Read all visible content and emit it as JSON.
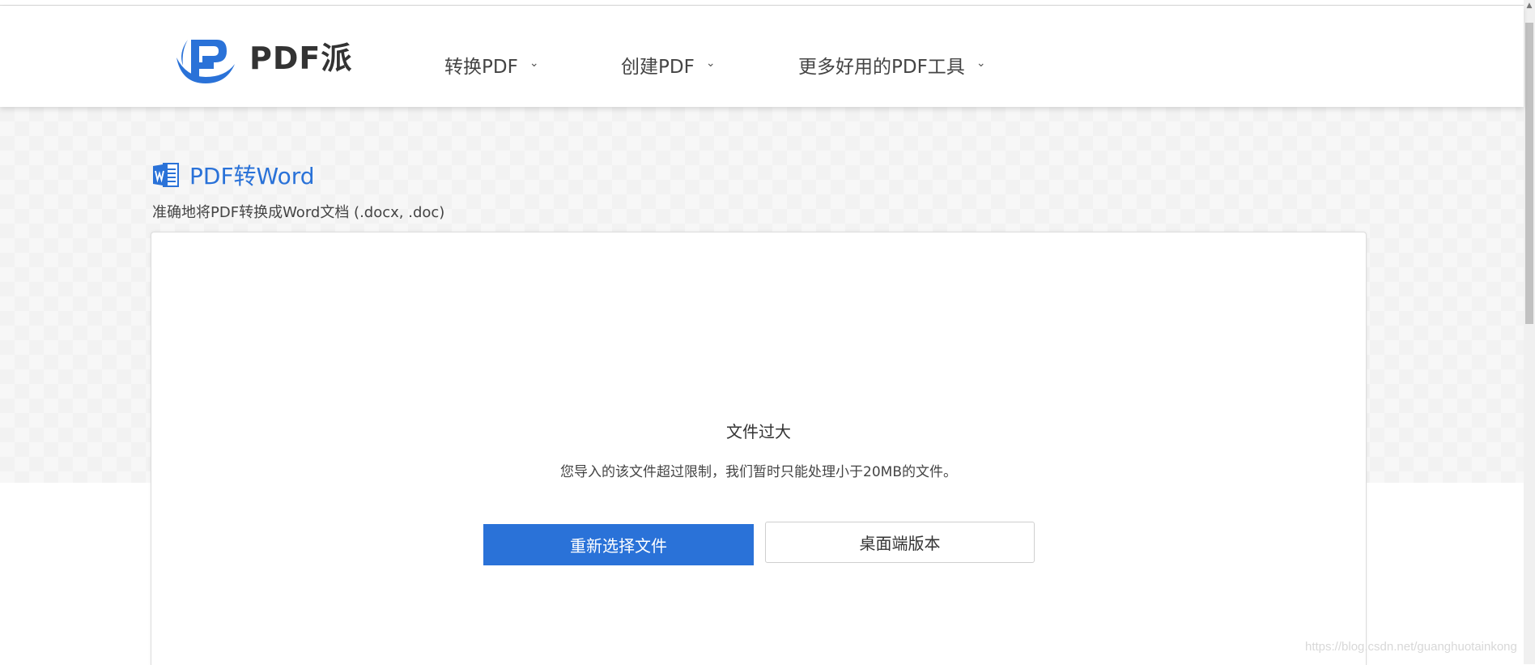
{
  "header": {
    "logo_text": "PDF派",
    "nav": [
      {
        "label": "转换PDF"
      },
      {
        "label": "创建PDF"
      },
      {
        "label": "更多好用的PDF工具"
      }
    ]
  },
  "tool": {
    "title": "PDF转Word",
    "subtitle": "准确地将PDF转换成Word文档 (.docx, .doc)"
  },
  "error": {
    "title": "文件过大",
    "message": "您导入的该文件超过限制，我们暂时只能处理小于20MB的文件。"
  },
  "buttons": {
    "reselect_label": "重新选择文件",
    "desktop_label": "桌面端版本"
  },
  "watermark": "https://blog.csdn.net/guanghuotainkong",
  "colors": {
    "accent": "#2a72d8",
    "background": "#f2f2f2"
  },
  "icons": {
    "logo": "pdfpai-logo-icon",
    "word": "word-doc-icon",
    "chevron": "chevron-down-icon"
  }
}
